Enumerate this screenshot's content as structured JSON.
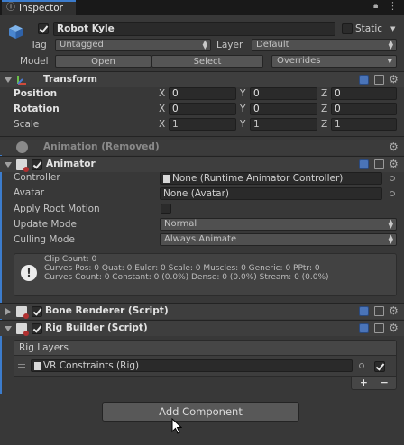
{
  "tab": {
    "title": "Inspector"
  },
  "object": {
    "name": "Robot Kyle",
    "static_label": "Static",
    "tag_label": "Tag",
    "tag_value": "Untagged",
    "layer_label": "Layer",
    "layer_value": "Default",
    "model_label": "Model",
    "open_label": "Open",
    "select_label": "Select",
    "overrides_label": "Overrides"
  },
  "transform": {
    "title": "Transform",
    "rows": [
      {
        "label": "Position",
        "x": "0",
        "y": "0",
        "z": "0"
      },
      {
        "label": "Rotation",
        "x": "0",
        "y": "0",
        "z": "0"
      },
      {
        "label": "Scale",
        "x": "1",
        "y": "1",
        "z": "1"
      }
    ],
    "axis": {
      "x": "X",
      "y": "Y",
      "z": "Z"
    }
  },
  "animation_removed": {
    "title": "Animation (Removed)"
  },
  "animator": {
    "title": "Animator",
    "controller_label": "Controller",
    "controller_value": "None (Runtime Animator Controller)",
    "avatar_label": "Avatar",
    "avatar_value": "None (Avatar)",
    "root_motion_label": "Apply Root Motion",
    "update_mode_label": "Update Mode",
    "update_mode_value": "Normal",
    "culling_mode_label": "Culling Mode",
    "culling_mode_value": "Always Animate",
    "info": {
      "line1": "Clip Count: 0",
      "line2": "Curves Pos: 0 Quat: 0 Euler: 0 Scale: 0 Muscles: 0 Generic: 0 PPtr: 0",
      "line3": "Curves Count: 0 Constant: 0 (0.0%) Dense: 0 (0.0%) Stream: 0 (0.0%)"
    }
  },
  "bone_renderer": {
    "title": "Bone Renderer (Script)"
  },
  "rig_builder": {
    "title": "Rig Builder (Script)",
    "list_header": "Rig Layers",
    "items": [
      {
        "value": "VR Constraints (Rig)"
      }
    ],
    "add": "+",
    "remove": "−"
  },
  "add_component": {
    "label": "Add Component"
  },
  "colors": {
    "accent": "#3c7ccc",
    "help_icon": "#4a74b8",
    "background": "#383838"
  }
}
